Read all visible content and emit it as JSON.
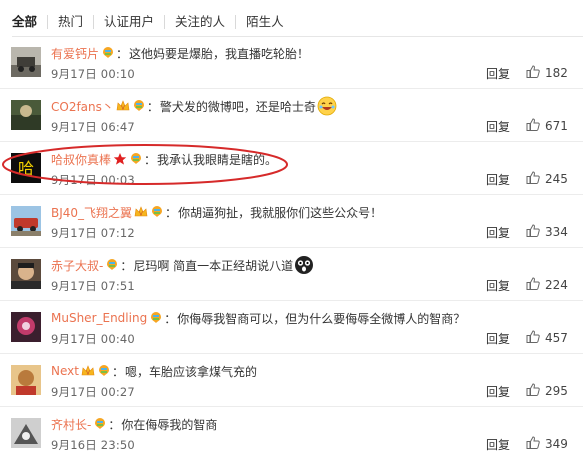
{
  "tabs": [
    "全部",
    "热门",
    "认证用户",
    "关注的人",
    "陌生人"
  ],
  "reply_label": "回复",
  "colors": {
    "username": "#eb7350",
    "highlight": "#d62a2a"
  },
  "icons": {
    "like": "thumbs-up-icon",
    "vip": "rainbow-balloon-icon"
  },
  "comments": [
    {
      "user": "有爱钙片",
      "text": "这他妈要是爆胎，我直播吃轮胎！",
      "time": "9月17日 00:10",
      "likes": "182"
    },
    {
      "user": "CO2fans丶",
      "text": "警犬发的微博吧，还是哈士奇",
      "time": "9月17日 06:47",
      "likes": "671"
    },
    {
      "user": "哈叔你真棒",
      "text": "我承认我眼睛是瞎的。",
      "time": "9月17日 00:03",
      "likes": "245"
    },
    {
      "user": "BJ40_飞翔之翼",
      "text": "你胡逼狗扯，我就服你们这些公众号！",
      "time": "9月17日 07:12",
      "likes": "334"
    },
    {
      "user": "赤子大叔-",
      "text": "尼玛啊 简直一本正经胡说八道",
      "time": "9月17日 07:51",
      "likes": "224"
    },
    {
      "user": "MuSher_Endling",
      "text": "你侮辱我智商可以，但为什么要侮辱全微博人的智商？",
      "time": "9月17日 00:40",
      "likes": "457"
    },
    {
      "user": "Next",
      "text": "嗯，车胎应该拿煤气充的",
      "time": "9月17日 00:27",
      "likes": "295"
    },
    {
      "user": "齐村长-",
      "text": "你在侮辱我的智商",
      "time": "9月16日 23:50",
      "likes": "349"
    }
  ]
}
